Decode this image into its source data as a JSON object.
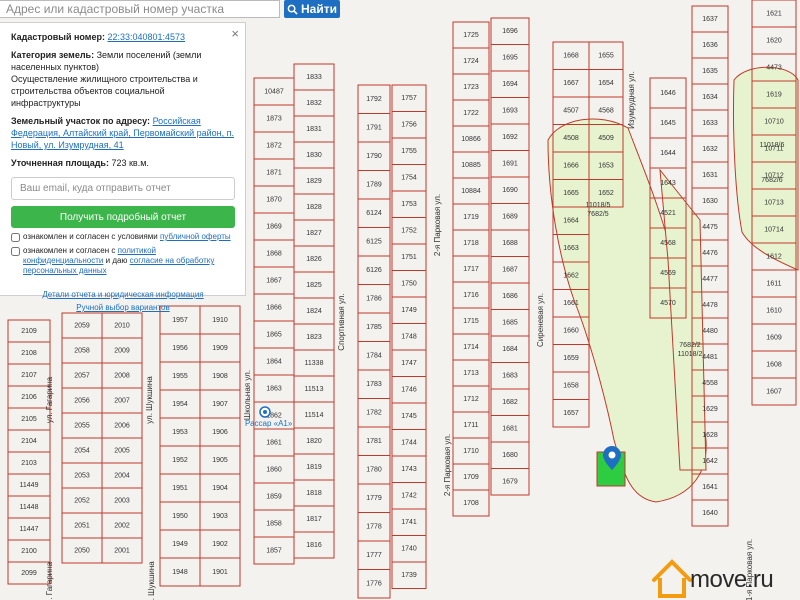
{
  "search": {
    "placeholder": "Адрес или кадастровый номер участка",
    "button_label": "Найти"
  },
  "panel": {
    "cadastral_label": "Кадастровый номер:",
    "cadastral_number": "22:33:040801:4573",
    "category_label": "Категория земель:",
    "category_value": "Земли поселений (земли населенных пунктов)",
    "use_value": "Осуществление жилищного строительства и строительства объектов социальной инфраструктуры",
    "address_label": "Земельный участок по адресу:",
    "address_value": "Российская Федерация, Алтайский край, Первомайский район, п. Новый, ул. Изумрудная, 41",
    "area_label": "Уточненная площадь:",
    "area_value": "723 кв.м.",
    "email_placeholder": "Ваш email, куда отправить отчет",
    "report_button": "Получить подробный отчет",
    "consent1_prefix": "ознакомлен и согласен с условиями",
    "consent1_link": "публичной оферты",
    "consent2_prefix": "ознакомлен и согласен с",
    "consent2_link": "политикой конфиденциальности",
    "consent2_middle": "и даю",
    "consent2_link2": "согласие на обработку персональных данных",
    "link_details": "Детали отчета и юридическая информация",
    "link_manual": "Ручной выбор вариантов"
  },
  "map": {
    "marker_label": "Рассар «А1»",
    "streets": [
      {
        "label": "ул. Гагарина"
      },
      {
        "label": "ул. Шукшина"
      },
      {
        "label": "Школьная ул."
      },
      {
        "label": "Спортивная ул."
      },
      {
        "label": "2-я Парковая ул."
      },
      {
        "label": "2-я Парковая ул."
      },
      {
        "label": "Сиреневая ул."
      },
      {
        "label": "Изумрудная ул."
      },
      {
        "label": "1-я Парковая ул."
      },
      {
        "label": "ул. Гагарина"
      },
      {
        "label": "ул. Шукшина"
      }
    ],
    "columns": [
      {
        "name": "col-a1",
        "labels": [
          "2109",
          "2108",
          "2107",
          "2106",
          "2105",
          "2104",
          "2103",
          "11449",
          "11448",
          "11447",
          "2100",
          "2099"
        ]
      },
      {
        "name": "col-a2",
        "labels": [
          "2059",
          "2058",
          "2057",
          "2056",
          "2055",
          "2054",
          "2053",
          "2052",
          "2051",
          "2050"
        ]
      },
      {
        "name": "col-a3",
        "labels": [
          "2010",
          "2009",
          "2008",
          "2007",
          "2006",
          "2005",
          "2004",
          "2003",
          "2002",
          "2001"
        ]
      },
      {
        "name": "col-b1",
        "labels": [
          "1957",
          "1956",
          "1955",
          "1954",
          "1953",
          "1952",
          "1951",
          "1950",
          "1949",
          "1948"
        ]
      },
      {
        "name": "col-b2",
        "labels": [
          "1910",
          "1909",
          "1908",
          "1907",
          "1906",
          "1905",
          "1904",
          "1903",
          "1902",
          "1901"
        ]
      },
      {
        "name": "col-c1",
        "labels": [
          "10487",
          "1873",
          "1872",
          "1871",
          "1870",
          "1869",
          "1868",
          "1867",
          "1866",
          "1865",
          "1864",
          "1863",
          "1862",
          "1861",
          "1860",
          "1859",
          "1858",
          "1857"
        ]
      },
      {
        "name": "col-c2",
        "labels": [
          "1833",
          "1832",
          "1831",
          "1830",
          "1829",
          "1828",
          "1827",
          "1826",
          "1825",
          "1824",
          "1823",
          "11338",
          "11513",
          "11514",
          "1820",
          "1819",
          "1818",
          "1817",
          "1816"
        ]
      },
      {
        "name": "col-d1",
        "labels": [
          "1792",
          "1791",
          "1790",
          "1789",
          "6124",
          "6125",
          "6126",
          "1786",
          "1785",
          "1784",
          "1783",
          "1782",
          "1781",
          "1780",
          "1779",
          "1778",
          "1777",
          "1776"
        ]
      },
      {
        "name": "col-d2",
        "labels": [
          "1757",
          "1756",
          "1755",
          "1754",
          "1753",
          "1752",
          "1751",
          "1750",
          "1749",
          "1748",
          "1747",
          "1746",
          "1745",
          "1744",
          "1743",
          "1742",
          "1741",
          "1740",
          "1739"
        ]
      },
      {
        "name": "col-e1",
        "labels": [
          "1725",
          "1724",
          "1723",
          "1722",
          "10866",
          "10885",
          "10884",
          "1719",
          "1718",
          "1717",
          "1716",
          "1715",
          "1714",
          "1713",
          "1712",
          "1711",
          "1710",
          "1709",
          "1708"
        ]
      },
      {
        "name": "col-e2",
        "labels": [
          "1696",
          "1695",
          "1694",
          "1693",
          "1692",
          "1691",
          "1690",
          "1689",
          "1688",
          "1687",
          "1686",
          "1685",
          "1684",
          "1683",
          "1682",
          "1681",
          "1680",
          "1679"
        ]
      },
      {
        "name": "col-f1",
        "labels": [
          "1668",
          "1667",
          "4507",
          "4508",
          "1666",
          "1665",
          "1664",
          "1663",
          "1662",
          "1661",
          "1660",
          "1659",
          "1658",
          "1657"
        ]
      },
      {
        "name": "col-f2",
        "labels": [
          "1655",
          "1654",
          "4568",
          "4509",
          "1653",
          "1652"
        ]
      },
      {
        "name": "col-g1",
        "labels": [
          "1637",
          "1636",
          "1635",
          "1634",
          "1633",
          "1632",
          "1631",
          "1630",
          "4475",
          "4476",
          "4477",
          "4478",
          "4480",
          "4481",
          "4558",
          "1629",
          "1628",
          "1642",
          "1641",
          "1640"
        ]
      },
      {
        "name": "col-g2",
        "labels": [
          "1621",
          "1620",
          "4473",
          "1619",
          "10710",
          "10711",
          "10712",
          "10713",
          "10714",
          "1612",
          "1611",
          "1610",
          "1609",
          "1608",
          "1607"
        ]
      },
      {
        "name": "col-h1",
        "labels": [
          "1646",
          "1645",
          "1644",
          "1643",
          "4521",
          "4568",
          "4569",
          "4570"
        ]
      }
    ],
    "parcel_labels_special": [
      {
        "label": "11018/5"
      },
      {
        "label": "7682/5"
      },
      {
        "label": "11018/6"
      },
      {
        "label": "7682/6"
      },
      {
        "label": "7682/2"
      },
      {
        "label": "11018/2"
      }
    ]
  },
  "watermark": {
    "text": "move.ru"
  },
  "colors": {
    "parcel_line": "#c0392b",
    "map_bg": "#f4f2ef",
    "green_area": "#e7f3cf",
    "selected_parcel": "#2ecc40",
    "link_blue": "#1e6fc1",
    "button_green": "#3cb54a",
    "watermark_orange": "#f39c12"
  }
}
